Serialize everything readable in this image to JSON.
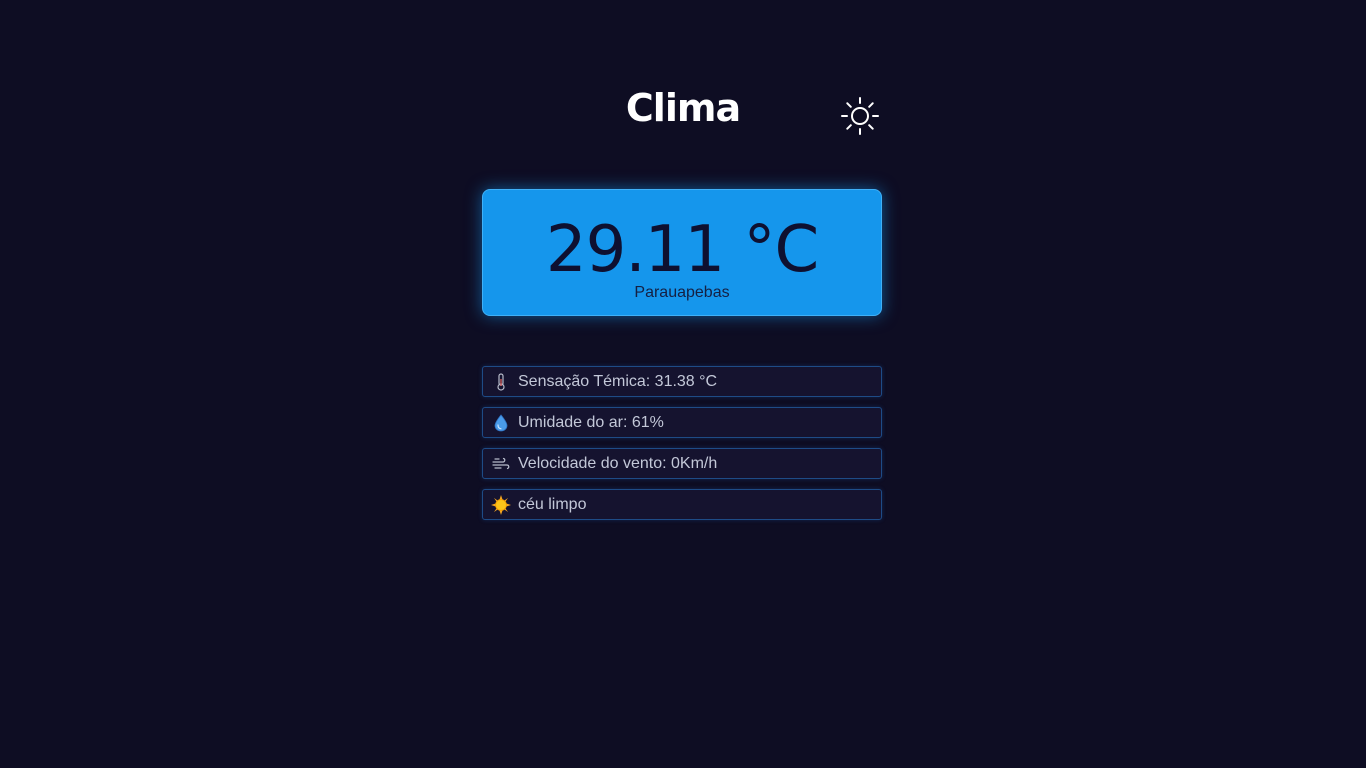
{
  "header": {
    "title": "Clima",
    "theme_toggle_icon": "sun-icon"
  },
  "weather": {
    "temperature": "29.11 °C",
    "city": "Parauapebas"
  },
  "details": [
    {
      "icon": "thermometer-icon",
      "text": "Sensação Témica: 31.38 °C"
    },
    {
      "icon": "water-drop-icon",
      "text": "Umidade do ar: 61%"
    },
    {
      "icon": "wind-icon",
      "text": "Velocidade do vento: 0Km/h"
    },
    {
      "icon": "sun-emoji-icon",
      "text": "céu limpo"
    }
  ],
  "colors": {
    "background": "#0e0d23",
    "card": "#1596ec",
    "row_border": "#1e4b86"
  }
}
